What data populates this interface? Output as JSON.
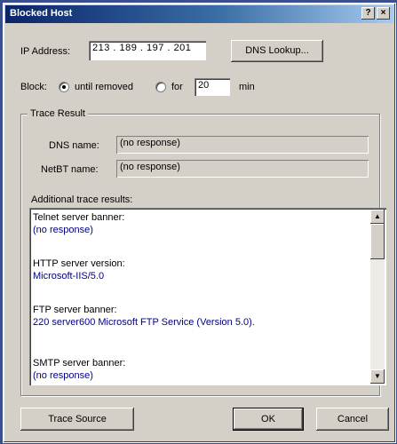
{
  "window": {
    "title": "Blocked Host",
    "help_glyph": "?",
    "close_glyph": "×"
  },
  "ip": {
    "label": "IP Address:",
    "value": "213 . 189 . 197 . 201"
  },
  "dns_button": "DNS Lookup...",
  "block": {
    "label": "Block:",
    "option1": "until removed",
    "option2": "for",
    "minutes_value": "20",
    "minutes_unit": "min",
    "selected": "until removed"
  },
  "trace": {
    "group_title": "Trace Result",
    "dns_label": "DNS name:",
    "dns_value": "(no response)",
    "netbt_label": "NetBT name:",
    "netbt_value": "(no response)",
    "additional_label": "Additional trace results:",
    "entries": [
      {
        "key": "Telnet server banner:",
        "value": "(no response)"
      },
      {
        "key": "HTTP server version:",
        "value": "Microsoft-IIS/5.0"
      },
      {
        "key": "FTP server banner:",
        "value": "220 server600 Microsoft FTP Service (Version 5.0)."
      },
      {
        "key": "SMTP server banner:",
        "value": "(no response)"
      }
    ]
  },
  "buttons": {
    "trace_source": "Trace Source",
    "ok": "OK",
    "cancel": "Cancel"
  }
}
